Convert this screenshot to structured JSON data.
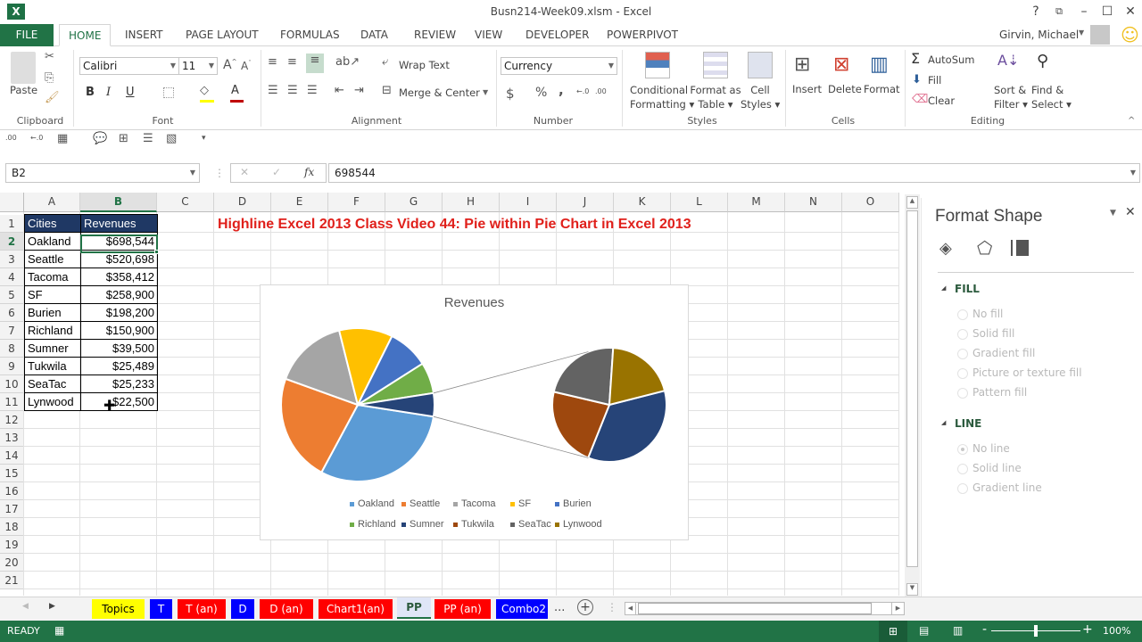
{
  "window": {
    "title": "Busn214-Week09.xlsm - Excel",
    "app_icon": "excel-icon",
    "controls": {
      "help": "?",
      "ribbon_options": "⧉",
      "minimize": "–",
      "maximize": "☐",
      "close": "✕"
    }
  },
  "ribbon_tabs": [
    "FILE",
    "HOME",
    "INSERT",
    "PAGE LAYOUT",
    "FORMULAS",
    "DATA",
    "REVIEW",
    "VIEW",
    "DEVELOPER",
    "POWERPIVOT"
  ],
  "active_tab": "HOME",
  "user": {
    "name": "Girvin, Michael",
    "smiley": "☺"
  },
  "ribbon": {
    "clipboard": {
      "label": "Clipboard",
      "paste": "Paste"
    },
    "font": {
      "label": "Font",
      "name": "Calibri",
      "size": "11",
      "bold": "B",
      "italic": "I",
      "underline": "U"
    },
    "alignment": {
      "label": "Alignment",
      "wrap_text": "Wrap Text",
      "merge_center": "Merge & Center"
    },
    "number": {
      "label": "Number",
      "format": "Currency",
      "dollar": "$",
      "percent": "%",
      "comma": ","
    },
    "styles": {
      "label": "Styles",
      "conditional_1": "Conditional",
      "conditional_2": "Formatting",
      "format_table_1": "Format as",
      "format_table_2": "Table",
      "cell_styles_1": "Cell",
      "cell_styles_2": "Styles"
    },
    "cells": {
      "label": "Cells",
      "insert": "Insert",
      "delete": "Delete",
      "format": "Format"
    },
    "editing": {
      "label": "Editing",
      "autosum": "AutoSum",
      "fill": "Fill",
      "clear": "Clear",
      "sort_1": "Sort &",
      "sort_2": "Filter",
      "find_1": "Find &",
      "find_2": "Select"
    }
  },
  "formula_bar": {
    "name_box": "B2",
    "fx": "fx",
    "value": "698544"
  },
  "columns": [
    "A",
    "B",
    "C",
    "D",
    "E",
    "F",
    "G",
    "H",
    "I",
    "J",
    "K",
    "L",
    "M",
    "N",
    "O"
  ],
  "rows": [
    "1",
    "2",
    "3",
    "4",
    "5",
    "6",
    "7",
    "8",
    "9",
    "10",
    "11",
    "12",
    "13",
    "14",
    "15",
    "16",
    "17",
    "18",
    "19",
    "20",
    "21"
  ],
  "table": {
    "headers": [
      "Cities",
      "Revenues"
    ],
    "rows": [
      [
        "Oakland",
        "$698,544"
      ],
      [
        "Seattle",
        "$520,698"
      ],
      [
        "Tacoma",
        "$358,412"
      ],
      [
        "SF",
        "$258,900"
      ],
      [
        "Burien",
        "$198,200"
      ],
      [
        "Richland",
        "$150,900"
      ],
      [
        "Sumner",
        "$39,500"
      ],
      [
        "Tukwila",
        "$25,489"
      ],
      [
        "SeaTac",
        "$25,233"
      ],
      [
        "Lynwood",
        "$22,500"
      ]
    ]
  },
  "banner": "Highline Excel 2013 Class Video 44: Pie within Pie Chart in Excel 2013",
  "chart_data": {
    "type": "pie",
    "subtype": "pie-of-pie",
    "title": "Revenues",
    "categories": [
      "Oakland",
      "Seattle",
      "Tacoma",
      "SF",
      "Burien",
      "Richland",
      "Sumner",
      "Tukwila",
      "SeaTac",
      "Lynwood"
    ],
    "values": [
      698544,
      520698,
      358412,
      258900,
      198200,
      150900,
      39500,
      25489,
      25233,
      22500
    ],
    "colors": [
      "#5b9bd5",
      "#ed7d31",
      "#a5a5a5",
      "#ffc000",
      "#4472c4",
      "#70ad47",
      "#264478",
      "#9e480e",
      "#636363",
      "#997300"
    ],
    "secondary_plot_count": 4,
    "legend_position": "bottom"
  },
  "format_pane": {
    "title": "Format Shape",
    "fill": {
      "label": "FILL",
      "options": [
        "No fill",
        "Solid fill",
        "Gradient fill",
        "Picture or texture fill",
        "Pattern fill"
      ]
    },
    "line": {
      "label": "LINE",
      "options": [
        "No line",
        "Solid line",
        "Gradient line"
      ],
      "selected": "No line"
    }
  },
  "sheet_tabs": [
    {
      "label": "Topics",
      "bg": "#ffff00",
      "fg": "#000000"
    },
    {
      "label": "T",
      "bg": "#0000ff",
      "fg": "#ffffff"
    },
    {
      "label": "T (an)",
      "bg": "#ff0000",
      "fg": "#ffffff"
    },
    {
      "label": "D",
      "bg": "#0000ff",
      "fg": "#ffffff"
    },
    {
      "label": "D (an)",
      "bg": "#ff0000",
      "fg": "#ffffff"
    },
    {
      "label": "Chart1(an)",
      "bg": "#ff0000",
      "fg": "#ffffff"
    },
    {
      "label": "PP",
      "bg": "#dfe6f7",
      "fg": "#2b5a3d",
      "active": true
    },
    {
      "label": "PP (an)",
      "bg": "#ff0000",
      "fg": "#ffffff"
    },
    {
      "label": "Combo2",
      "bg": "#0000ff",
      "fg": "#ffffff"
    }
  ],
  "sheet_tabs_more": "...",
  "status": {
    "mode": "READY",
    "zoom": "100%",
    "zoom_level_percent": 100
  }
}
